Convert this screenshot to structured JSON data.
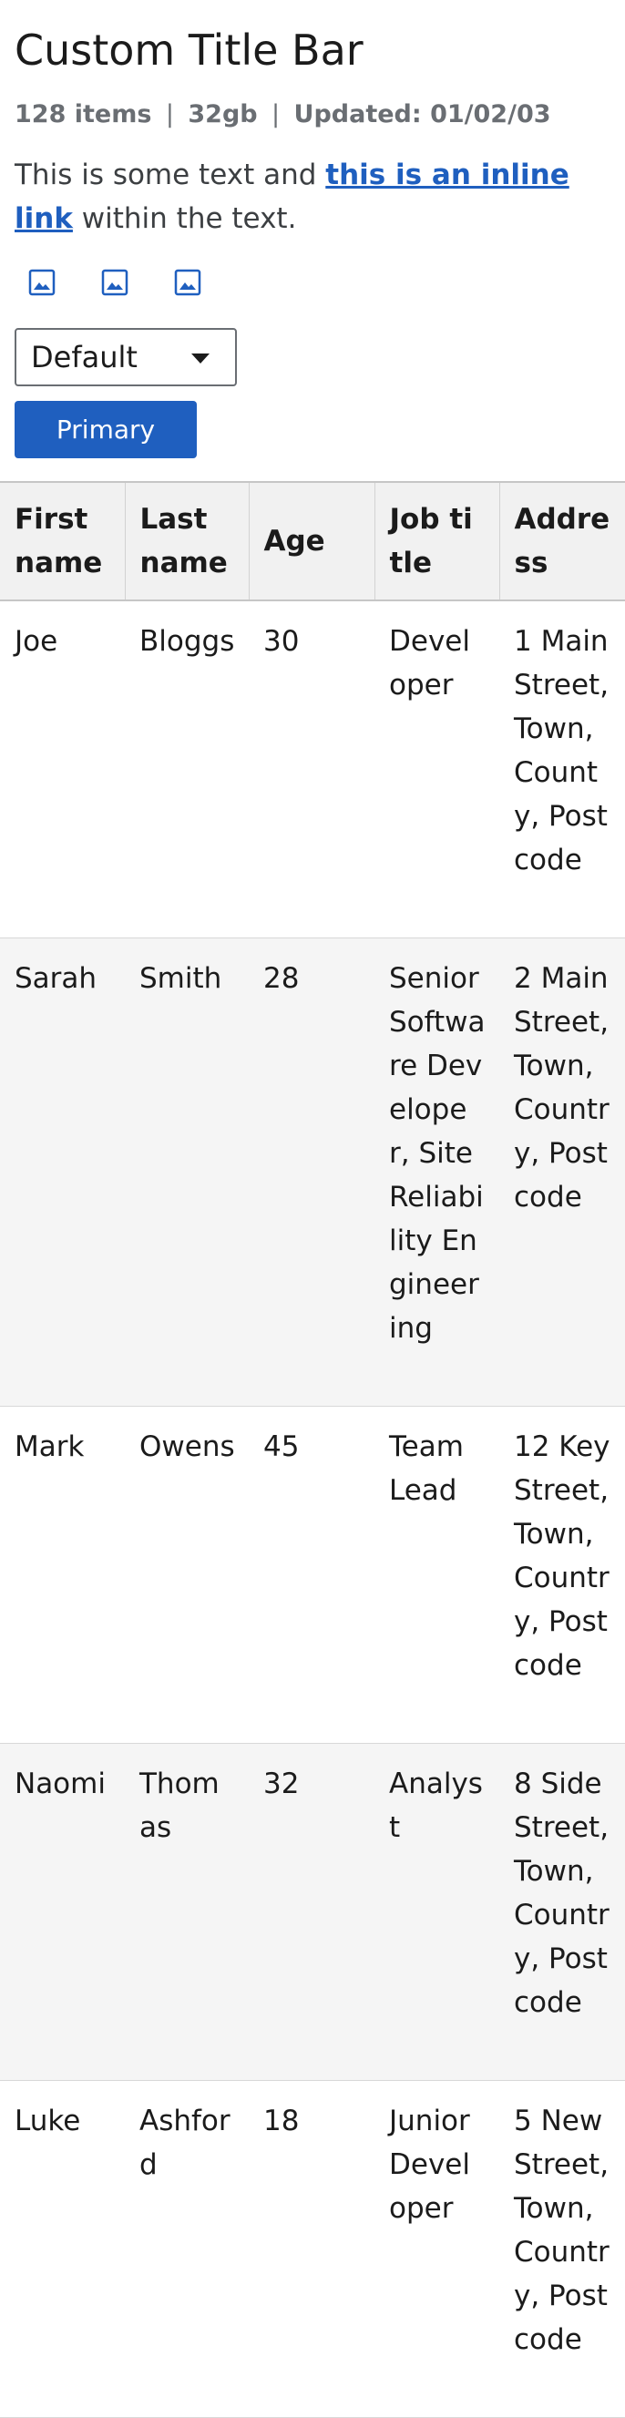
{
  "header": {
    "title": "Custom Title Bar",
    "meta": {
      "items": "128 items",
      "size": "32gb",
      "updated": "Updated: 01/02/03",
      "separator": "|"
    }
  },
  "paragraph": {
    "before_link": "This is some text and ",
    "link": "this is an inline link",
    "after_link": " within the text."
  },
  "icon_buttons": [
    "image-icon",
    "image-icon",
    "image-icon"
  ],
  "select": {
    "value": "Default"
  },
  "primary_button": {
    "label": "Primary"
  },
  "colors": {
    "accent": "#1f5fbf",
    "meta_text": "#6a6e73",
    "header_bg": "#f1f1f1",
    "stripe_bg": "#f5f5f5"
  },
  "table": {
    "columns": [
      "First name",
      "Last name",
      "Age",
      "Job title",
      "Address"
    ],
    "rows": [
      [
        "Joe",
        "Bloggs",
        "30",
        "Developer",
        "1 Main Street, Town, County, Postcode"
      ],
      [
        "Sarah",
        "Smith",
        "28",
        "Senior Software Developer, Site Reliability Engineering",
        "2 Main Street, Town, Country, Postcode"
      ],
      [
        "Mark",
        "Owens",
        "45",
        "Team Lead",
        "12 Key Street, Town, Country, Postcode"
      ],
      [
        "Naomi",
        "Thomas",
        "32",
        "Analyst",
        "8 Side Street, Town, Country, Postcode"
      ],
      [
        "Luke",
        "Ashford",
        "18",
        "Junior Developer",
        "5 New Street, Town, Country, Postcode"
      ]
    ]
  }
}
